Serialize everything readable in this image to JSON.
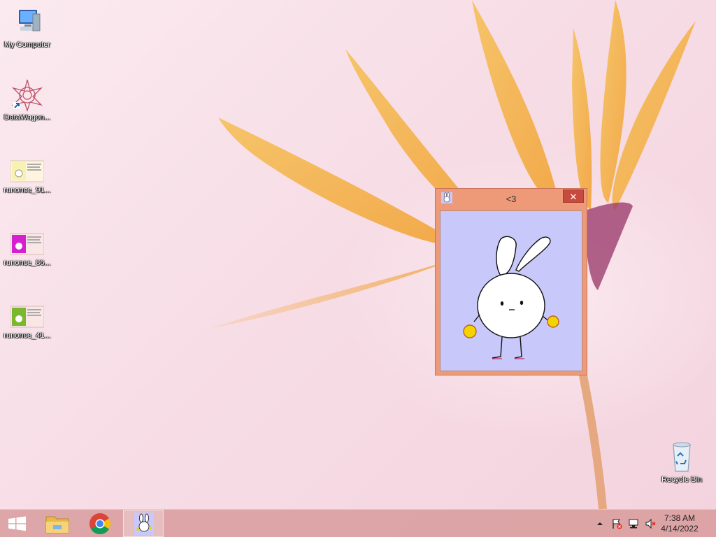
{
  "desktop": {
    "icons": [
      {
        "label": "My Computer",
        "icon": "computer-icon"
      },
      {
        "label": "DataWagon...",
        "icon": "datawagon-icon"
      },
      {
        "label": "runonce_91...",
        "icon": "runonce-thumbnail-icon"
      },
      {
        "label": "runonce_86...",
        "icon": "runonce-thumbnail-icon"
      },
      {
        "label": "runonce_41...",
        "icon": "runonce-thumbnail-icon"
      },
      {
        "label": "Recycle Bin",
        "icon": "recycle-bin-icon"
      }
    ]
  },
  "window": {
    "title": "<3",
    "close_glyph": "✕",
    "accent": "#ee9a78",
    "client_background": "#c8c8fb"
  },
  "taskbar": {
    "buttons": [
      {
        "name": "start",
        "icon": "windows-logo-icon"
      },
      {
        "name": "file-explorer",
        "icon": "folder-icon"
      },
      {
        "name": "chrome",
        "icon": "chrome-icon"
      },
      {
        "name": "bunny-app",
        "icon": "bunny-icon",
        "active": true
      }
    ],
    "tray": {
      "icons": [
        "show-hidden-icons-chevron",
        "action-center-flag-icon",
        "network-icon",
        "volume-muted-icon"
      ],
      "time": "7:38 AM",
      "date": "4/14/2022"
    }
  }
}
